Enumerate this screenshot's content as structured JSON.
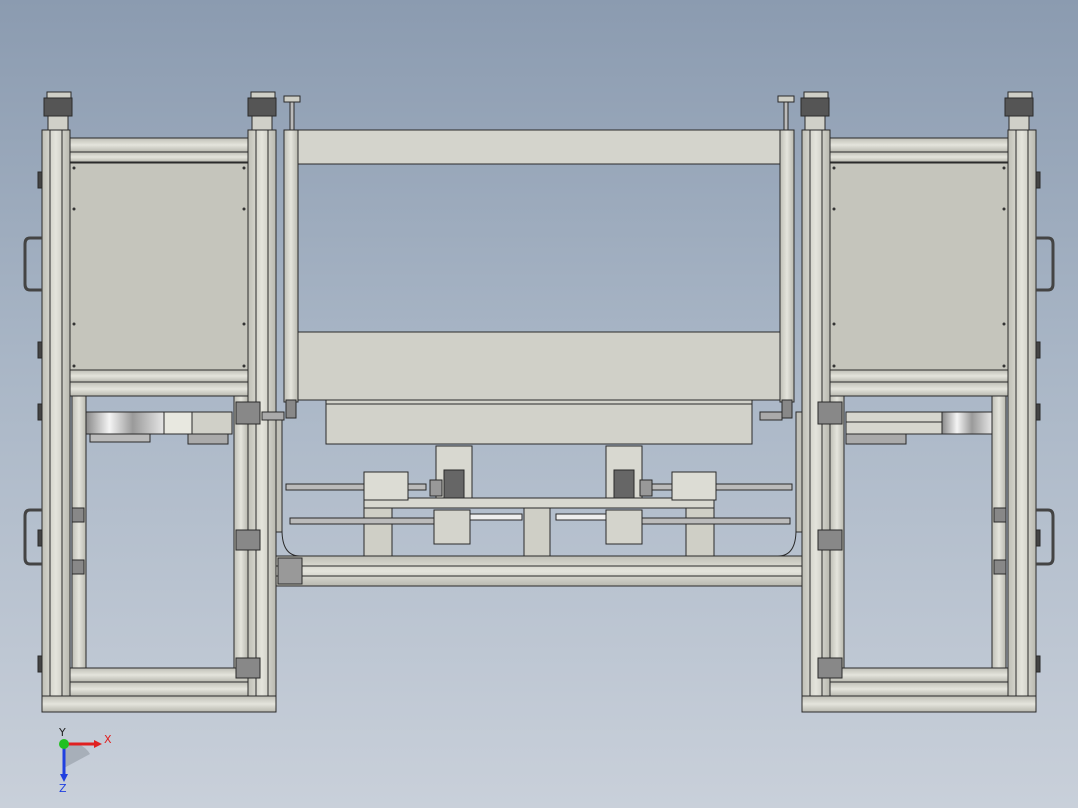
{
  "viewport": {
    "background_top": "#8b9bb0",
    "background_bottom": "#c9d0da",
    "model_fill": "#d9d9d0",
    "model_edge": "#2a2a2a",
    "panel_fill": "#c8c8bf"
  },
  "triad": {
    "x_label": "X",
    "y_label": "Y",
    "z_label": "Z",
    "x_color": "#e02020",
    "y_color": "#20c020",
    "z_color": "#2040e0"
  }
}
